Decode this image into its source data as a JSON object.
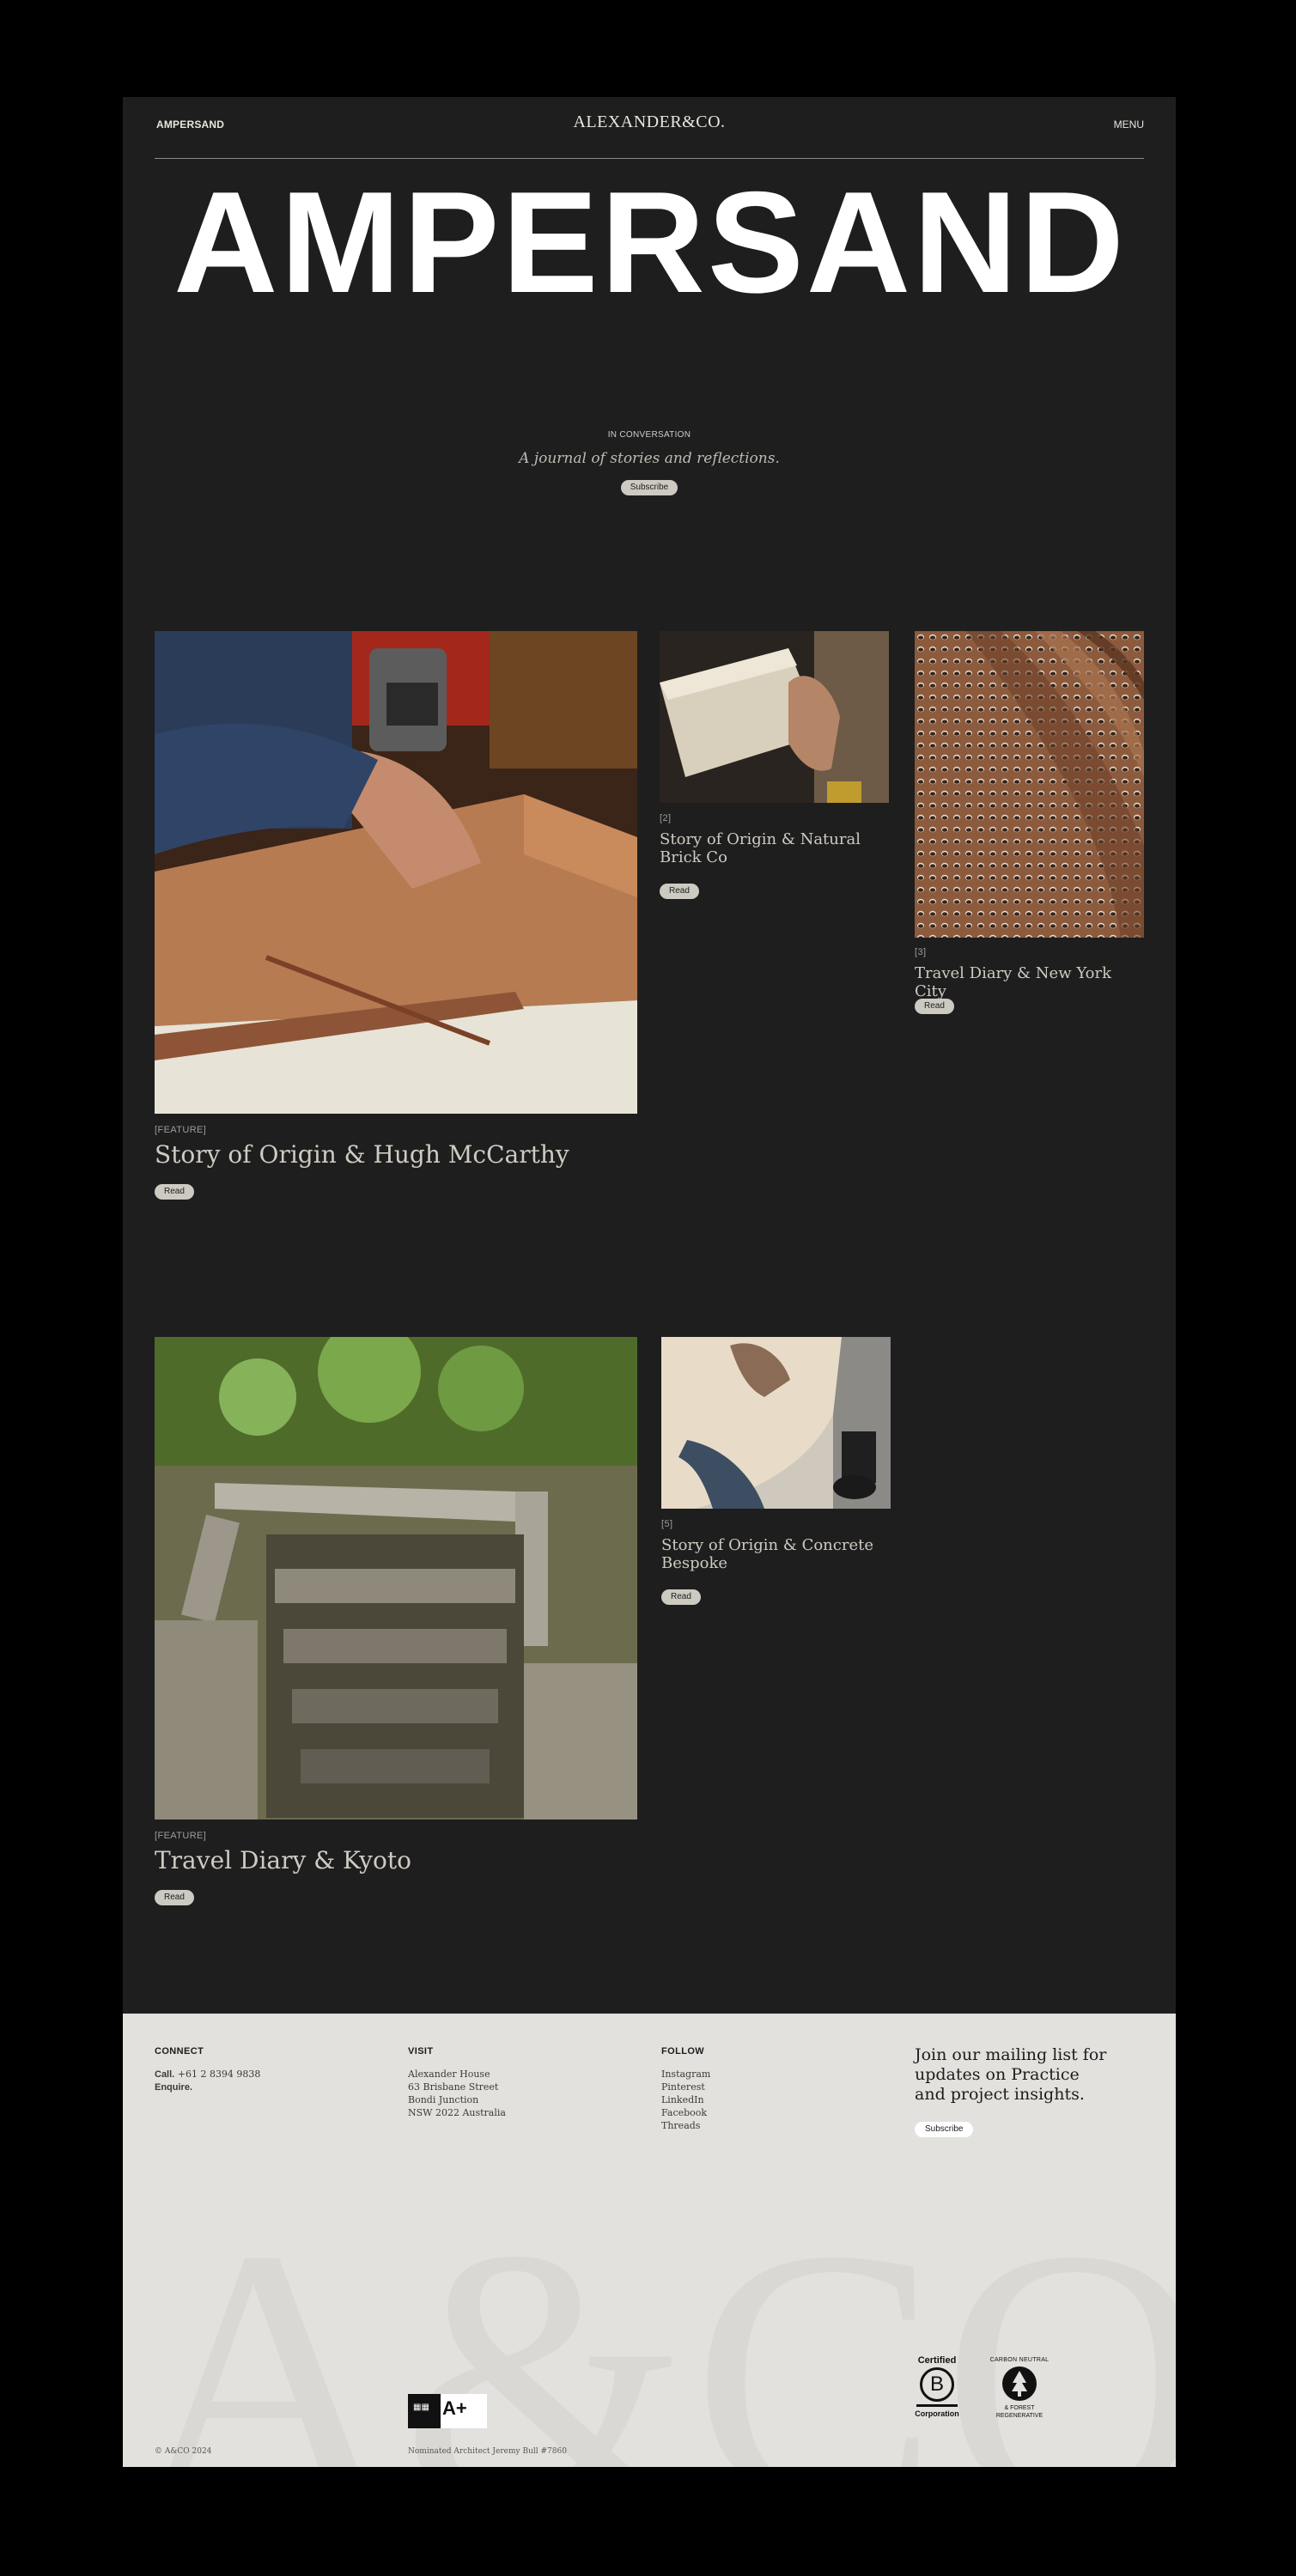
{
  "header": {
    "left_label": "AMPERSAND",
    "logo": "ALEXANDER&CO.",
    "menu_label": "MENU"
  },
  "hero": {
    "wordmark": "AMPERSAND"
  },
  "intro": {
    "eyebrow": "IN CONVERSATION",
    "tagline": "A journal of stories and reflections.",
    "subscribe_label": "Subscribe"
  },
  "articles": [
    {
      "tag": "[FEATURE]",
      "title": "Story of Origin & Hugh McCarthy",
      "read_label": "Read",
      "image_icon": "woodwork-photo"
    },
    {
      "tag": "[2]",
      "title": "Story of Origin & Natural Brick Co",
      "read_label": "Read",
      "image_icon": "brick-photo"
    },
    {
      "tag": "[3]",
      "title": "Travel Diary & New York City",
      "read_label": "Read",
      "image_icon": "grate-photo"
    },
    {
      "tag": "[FEATURE]",
      "title": "Travel Diary & Kyoto",
      "read_label": "Read",
      "image_icon": "stone-steps-photo"
    },
    {
      "tag": "[5]",
      "title": "Story of Origin & Concrete Bespoke",
      "read_label": "Read",
      "image_icon": "concrete-photo"
    }
  ],
  "footer": {
    "connect": {
      "heading": "CONNECT",
      "call_label": "Call.",
      "phone": "+61 2 8394 9838",
      "enquire_label": "Enquire."
    },
    "visit": {
      "heading": "VISIT",
      "lines": [
        "Alexander House",
        "63 Brisbane Street",
        "Bondi Junction",
        "NSW 2022 Australia"
      ]
    },
    "follow": {
      "heading": "FOLLOW",
      "links": [
        "Instagram",
        "Pinterest",
        "LinkedIn",
        "Facebook",
        "Threads"
      ]
    },
    "mailing": {
      "text": "Join our mailing list for updates on Practice and project insights.",
      "subscribe_label": "Subscribe"
    },
    "watermark": "A&CO.",
    "copyright": "© A&CO 2024",
    "architect_note": "Nominated Architect Jeremy Bull #7860",
    "bcorp": {
      "line1": "Certified",
      "letter": "B",
      "line2": "Corporation"
    },
    "carbon_badge": {
      "top": "CARBON NEUTRAL",
      "bottom": "& FOREST REGENERATIVE"
    },
    "aplus_logo": "A+"
  },
  "colors": {
    "page_bg": "#1e1e1e",
    "outer_bg": "#000000",
    "footer_bg": "#e2e1dd",
    "pill_bg": "#cdcac2",
    "title_text": "#cfcbc2"
  }
}
